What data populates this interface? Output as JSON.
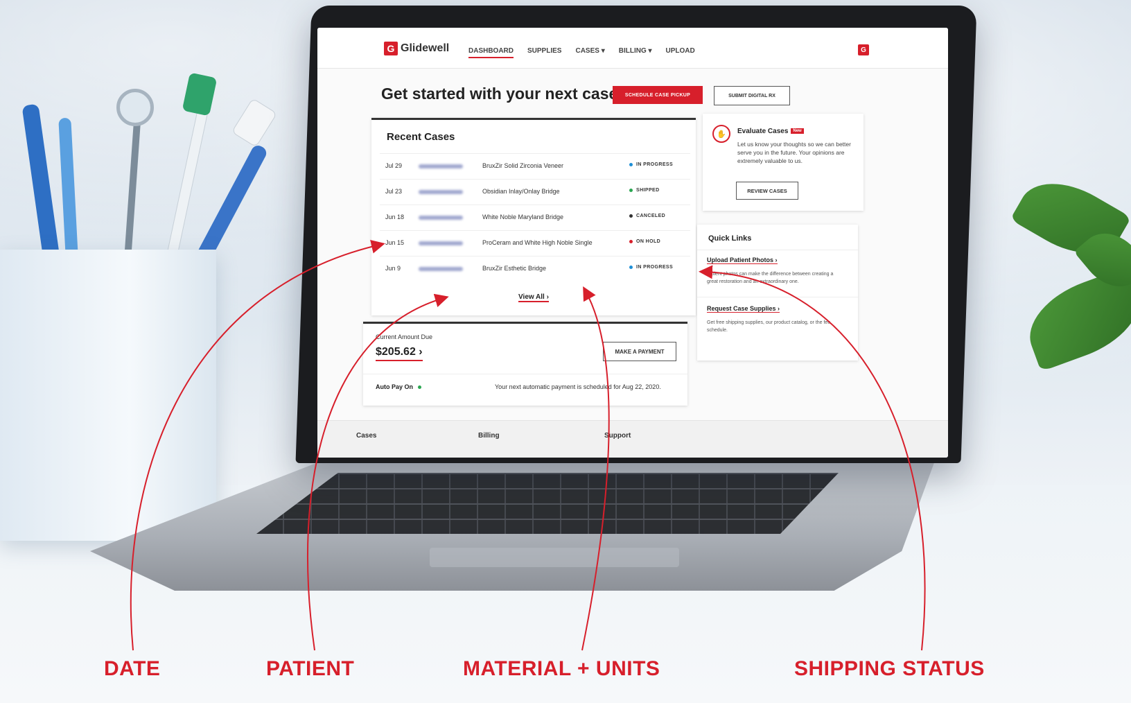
{
  "brand": {
    "name": "Glidewell",
    "accent": "#d71f2b",
    "logo_letter": "G"
  },
  "nav": {
    "items": [
      "DASHBOARD",
      "SUPPLIES",
      "CASES ▾",
      "BILLING ▾",
      "UPLOAD"
    ],
    "active": "DASHBOARD",
    "user_icon": "G"
  },
  "hero": {
    "title": "Get started with your next case",
    "primary_button": "SCHEDULE CASE PICKUP",
    "secondary_button": "SUBMIT DIGITAL RX"
  },
  "recent_cases": {
    "title": "Recent Cases",
    "rows": [
      {
        "date": "Jul 29",
        "material": "BruxZir Solid Zirconia Veneer",
        "status": "IN PROGRESS",
        "status_color": "#1e8fd6"
      },
      {
        "date": "Jul 23",
        "material": "Obsidian Inlay/Onlay Bridge",
        "status": "SHIPPED",
        "status_color": "#2aa651"
      },
      {
        "date": "Jun 18",
        "material": "White Noble Maryland Bridge",
        "status": "CANCELED",
        "status_color": "#333333"
      },
      {
        "date": "Jun 15",
        "material": "ProCeram and White High Noble Single",
        "status": "ON HOLD",
        "status_color": "#d71f2b"
      },
      {
        "date": "Jun 9",
        "material": "BruxZir Esthetic Bridge",
        "status": "IN PROGRESS",
        "status_color": "#1e8fd6"
      }
    ],
    "view_all": "View All ›"
  },
  "billing": {
    "label": "Current Amount Due",
    "amount": "$205.62 ›",
    "pay_button": "MAKE A PAYMENT",
    "autopay": "Auto Pay On",
    "next_payment": "Your next automatic payment is scheduled for Aug 22, 2020."
  },
  "evaluate": {
    "title": "Evaluate Cases",
    "badge": "New",
    "body": "Let us know your thoughts so we can better serve you in the future. Your opinions are extremely valuable to us.",
    "button": "REVIEW CASES"
  },
  "quick_links": {
    "title": "Quick Links",
    "items": [
      {
        "label": "Upload Patient Photos ›",
        "desc": "Patient photos can make the difference between creating a great restoration and an extraordinary one."
      },
      {
        "label": "Request Case Supplies ›",
        "desc": "Get free shipping supplies, our product catalog, or the fee schedule."
      }
    ]
  },
  "footer": {
    "cols": [
      "Cases",
      "Billing",
      "Support"
    ]
  },
  "annotations": {
    "labels": [
      "DATE",
      "PATIENT",
      "MATERIAL + UNITS",
      "SHIPPING STATUS"
    ],
    "color": "#d71f2b"
  }
}
